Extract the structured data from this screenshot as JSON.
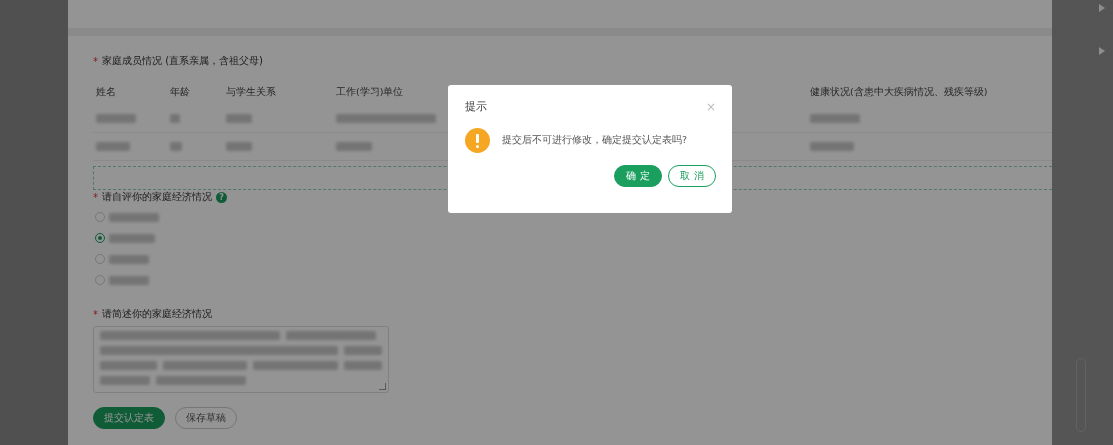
{
  "family_section": {
    "title": "家庭成员情况 (直系亲属，含祖父母)",
    "required_mark": "*",
    "columns": [
      "姓名",
      "年龄",
      "与学生关系",
      "工作(学习)单位",
      "健康状况(含患中大疾病情况、残疾等级)"
    ],
    "rows": [
      {
        "redacted": true
      },
      {
        "redacted": true
      }
    ]
  },
  "economy_rating": {
    "title": "请自评你的家庭经济情况",
    "required_mark": "*",
    "help": "?",
    "options": [
      {
        "selected": false,
        "redacted": true
      },
      {
        "selected": true,
        "redacted": true
      },
      {
        "selected": false,
        "redacted": true
      },
      {
        "selected": false,
        "redacted": true
      }
    ]
  },
  "economy_description": {
    "title": "请简述你的家庭经济情况",
    "required_mark": "*",
    "redacted": true
  },
  "actions": [
    {
      "label": "提交认定表",
      "kind": "primary"
    },
    {
      "label": "保存草稿",
      "kind": "secondary"
    }
  ],
  "dialog": {
    "title": "提示",
    "message": "提交后不可进行修改，确定提交认定表吗?",
    "close": "×",
    "buttons": [
      {
        "label": "确 定",
        "kind": "primary"
      },
      {
        "label": "取 消",
        "kind": "secondary"
      }
    ]
  }
}
